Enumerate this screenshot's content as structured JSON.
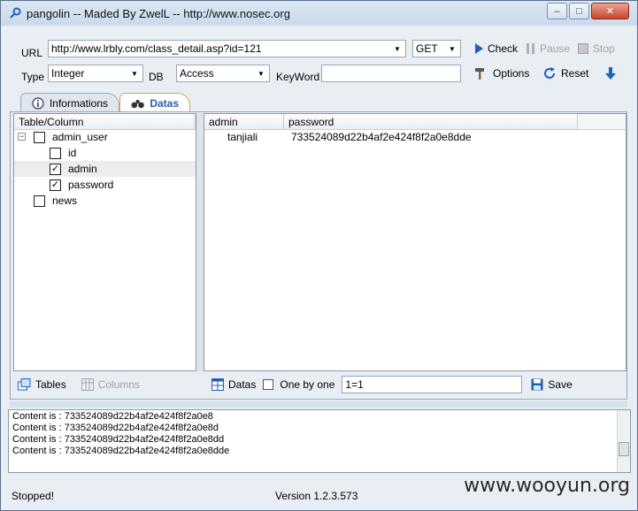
{
  "window": {
    "title": "pangolin -- Maded By ZwelL -- http://www.nosec.org",
    "minimize": "–",
    "maximize": "□",
    "close": "✕"
  },
  "form": {
    "url_label": "URL",
    "url_value": "http://www.lrbly.com/class_detail.asp?id=121",
    "method_value": "GET",
    "type_label": "Type",
    "type_value": "Integer",
    "db_label": "DB",
    "db_value": "Access",
    "keyword_label": "KeyWord",
    "keyword_value": ""
  },
  "toolbar": {
    "check": "Check",
    "pause": "Pause",
    "stop": "Stop",
    "options": "Options",
    "reset": "Reset"
  },
  "tabs": [
    {
      "label": "Informations",
      "active": false
    },
    {
      "label": "Datas",
      "active": true
    }
  ],
  "tree": {
    "header": "Table/Column",
    "nodes": [
      {
        "label": "admin_user",
        "checked": false,
        "level": 0,
        "expander": "−"
      },
      {
        "label": "id",
        "checked": false,
        "level": 1
      },
      {
        "label": "admin",
        "checked": true,
        "level": 1
      },
      {
        "label": "password",
        "checked": true,
        "level": 1
      },
      {
        "label": "news",
        "checked": false,
        "level": 0
      }
    ]
  },
  "grid": {
    "columns": [
      "admin",
      "password"
    ],
    "rows": [
      [
        "tanjiali",
        "733524089d22b4af2e424f8f2a0e8dde"
      ]
    ]
  },
  "left_footer": {
    "tables": "Tables",
    "columns": "Columns"
  },
  "right_footer": {
    "datas": "Datas",
    "one_by_one": "One by one",
    "one_by_one_checked": false,
    "condition": "1=1",
    "save": "Save"
  },
  "log": [
    "Content is : 733524089d22b4af2e424f8f2a0e8",
    "Content is : 733524089d22b4af2e424f8f2a0e8d",
    "Content is : 733524089d22b4af2e424f8f2a0e8dd",
    "Content is : 733524089d22b4af2e424f8f2a0e8dde"
  ],
  "status": {
    "state": "Stopped!",
    "version": "Version  1.2.3.573"
  },
  "watermark": "www.wooyun.org",
  "colors": {
    "accent": "#2b5fa8",
    "tab_highlight": "#e0a050",
    "selection": "#ededed"
  },
  "icons": {
    "app": "key-icon",
    "check": "play-icon",
    "pause": "pause-icon",
    "stop": "stop-icon",
    "options": "hammer-icon",
    "reset": "refresh-icon",
    "download": "down-arrow-icon",
    "info": "info-icon",
    "datas_tab": "binoculars-icon",
    "tables": "tables-icon",
    "columns": "columns-icon",
    "datas": "grid-icon",
    "save": "floppy-disk-icon"
  }
}
